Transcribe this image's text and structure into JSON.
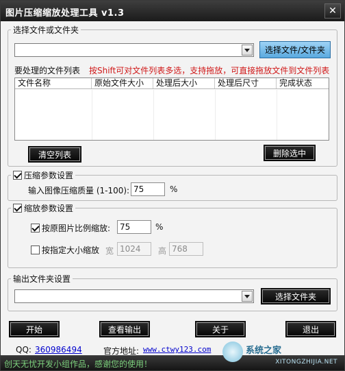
{
  "window": {
    "title": "图片压缩缩放处理工具 v1.3",
    "close_glyph": "✕"
  },
  "file_group": {
    "legend": "选择文件或文件夹",
    "path_value": "",
    "select_button": "选择文件/文件夹",
    "list_label": "要处理的文件列表",
    "hint": "按Shift可对文件列表多选，支持拖放，可直接拖放文件到文件列表",
    "columns": [
      "文件名称",
      "原始文件大小",
      "处理后大小",
      "处理后尺寸",
      "完成状态"
    ],
    "clear_button": "清空列表",
    "delete_button": "删除选中"
  },
  "compress_group": {
    "legend": "压缩参数设置",
    "checked": true,
    "quality_label": "输入图像压缩质量 (1-100):",
    "quality_value": "75",
    "unit": "%"
  },
  "scale_group": {
    "legend": "缩放参数设置",
    "checked": true,
    "ratio_label": "按原图片比例缩放:",
    "ratio_checked": true,
    "ratio_value": "75",
    "ratio_unit": "%",
    "size_label": "按指定大小缩放",
    "size_checked": false,
    "width_label": "宽",
    "width_value": "1024",
    "height_label": "高",
    "height_value": "768"
  },
  "output_group": {
    "legend": "输出文件夹设置",
    "path_value": "",
    "select_button": "选择文件夹"
  },
  "actions": {
    "start": "开始",
    "view_output": "查看输出",
    "about": "关于",
    "exit": "退出"
  },
  "info": {
    "qq_label": "QQ:",
    "qq_value": "360986494",
    "site_label": "官方地址:",
    "site_value": "www.ctwy123.com"
  },
  "status": {
    "text": "创天无忧开发小组作品，感谢您的使用！"
  },
  "watermark": {
    "site": "XITONGZHIJIA.NET",
    "name": "系统之家"
  },
  "colors": {
    "hint": "#d01818",
    "link": "#0000cc",
    "status_text": "#7cd07c",
    "titlebar": "#1b1b1b"
  }
}
